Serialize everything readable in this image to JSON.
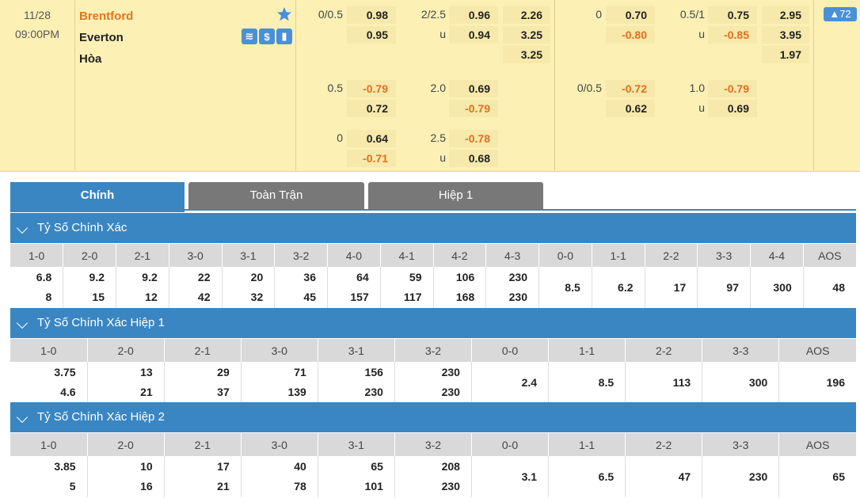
{
  "match": {
    "date": "11/28",
    "time": "09:00PM",
    "home": "Brentford",
    "away": "Everton",
    "draw": "Hòa",
    "more_count": "72",
    "icons": [
      "standings-icon",
      "dollar-icon",
      "stats-icon"
    ],
    "icon_glyphs": [
      "≋",
      "$",
      "▮"
    ],
    "colors": {
      "accent": "#3a86c2",
      "negative": "#e07020",
      "highlight": "#fdf0b5"
    },
    "ft": {
      "rows": [
        {
          "hcap": "0/0.5",
          "hcap_odds": [
            "0.98",
            "0.95"
          ],
          "ou": "2/2.5",
          "ou_u": "u",
          "ou_odds": [
            "0.96",
            "0.94"
          ],
          "x12": [
            "2.26",
            "3.25",
            "3.25"
          ]
        },
        {
          "hcap": "0.5",
          "hcap_odds": [
            "-0.79",
            "0.72"
          ],
          "ou": "2.0",
          "ou_u": "",
          "ou_odds": [
            "0.69",
            "-0.79"
          ]
        },
        {
          "hcap": "0",
          "hcap_odds": [
            "0.64",
            "-0.71"
          ],
          "ou": "2.5",
          "ou_u": "u",
          "ou_odds": [
            "-0.78",
            "0.68"
          ]
        }
      ]
    },
    "h1": {
      "rows": [
        {
          "hcap": "0",
          "hcap_odds": [
            "0.70",
            "-0.80"
          ],
          "ou": "0.5/1",
          "ou_u": "u",
          "ou_odds": [
            "0.75",
            "-0.85"
          ],
          "x12": [
            "2.95",
            "3.95",
            "1.97"
          ]
        },
        {
          "hcap": "0/0.5",
          "hcap_odds": [
            "-0.72",
            "0.62"
          ],
          "ou": "1.0",
          "ou_u": "u",
          "ou_odds": [
            "-0.79",
            "0.69"
          ]
        }
      ]
    }
  },
  "tabs": [
    "Chính",
    "Toàn Trận",
    "Hiệp 1"
  ],
  "sections": [
    {
      "title": "Tỷ Số Chính Xác",
      "headers": [
        "1-0",
        "2-0",
        "2-1",
        "3-0",
        "3-1",
        "3-2",
        "4-0",
        "4-1",
        "4-2",
        "4-3",
        "0-0",
        "1-1",
        "2-2",
        "3-3",
        "4-4",
        "AOS"
      ],
      "values": [
        [
          "6.8",
          "8"
        ],
        [
          "9.2",
          "15"
        ],
        [
          "9.2",
          "12"
        ],
        [
          "22",
          "42"
        ],
        [
          "20",
          "32"
        ],
        [
          "36",
          "45"
        ],
        [
          "64",
          "157"
        ],
        [
          "59",
          "117"
        ],
        [
          "106",
          "168"
        ],
        [
          "230",
          "230"
        ],
        [
          "8.5"
        ],
        [
          "6.2"
        ],
        [
          "17"
        ],
        [
          "97"
        ],
        [
          "300"
        ],
        [
          "48"
        ]
      ]
    },
    {
      "title": "Tỷ Số Chính Xác Hiệp 1",
      "headers": [
        "1-0",
        "2-0",
        "2-1",
        "3-0",
        "3-1",
        "3-2",
        "0-0",
        "1-1",
        "2-2",
        "3-3",
        "AOS"
      ],
      "values": [
        [
          "3.75",
          "4.6"
        ],
        [
          "13",
          "21"
        ],
        [
          "29",
          "37"
        ],
        [
          "71",
          "139"
        ],
        [
          "156",
          "230"
        ],
        [
          "230",
          "230"
        ],
        [
          "2.4"
        ],
        [
          "8.5"
        ],
        [
          "113"
        ],
        [
          "300"
        ],
        [
          "196"
        ]
      ]
    },
    {
      "title": "Tỷ Số Chính Xác Hiệp 2",
      "headers": [
        "1-0",
        "2-0",
        "2-1",
        "3-0",
        "3-1",
        "3-2",
        "0-0",
        "1-1",
        "2-2",
        "3-3",
        "AOS"
      ],
      "values": [
        [
          "3.85",
          "5"
        ],
        [
          "10",
          "16"
        ],
        [
          "17",
          "21"
        ],
        [
          "40",
          "78"
        ],
        [
          "65",
          "101"
        ],
        [
          "208",
          "230"
        ],
        [
          "3.1"
        ],
        [
          "6.5"
        ],
        [
          "47"
        ],
        [
          "230"
        ],
        [
          "65"
        ]
      ]
    }
  ]
}
